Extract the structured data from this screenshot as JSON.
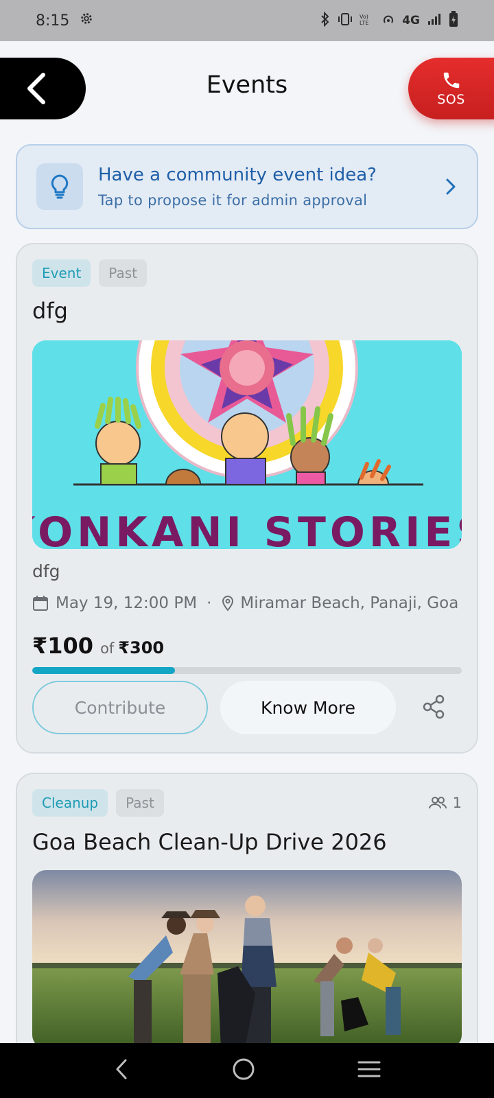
{
  "status": {
    "time": "8:15",
    "network": "4G"
  },
  "header": {
    "title": "Events",
    "sos_label": "SOS"
  },
  "idea_banner": {
    "title": "Have a community event idea?",
    "subtitle": "Tap to propose it for admin approval"
  },
  "events": [
    {
      "category": "Event",
      "status": "Past",
      "title": "dfg",
      "image_text": "KONKANI STORIES",
      "description": "dfg",
      "date": "May 19, 12:00 PM",
      "separator": "·",
      "location": "Miramar Beach, Panaji, Goa",
      "raised": "₹100",
      "of_label": "of",
      "goal": "₹300",
      "progress_fraction": 0.333,
      "contribute_label": "Contribute",
      "know_more_label": "Know More"
    },
    {
      "category": "Cleanup",
      "status": "Past",
      "participants": "1",
      "title": "Goa Beach Clean-Up Drive 2026"
    }
  ],
  "colors": {
    "accent": "#12a6c4",
    "sos": "#d72626",
    "idea_text": "#1f5fa8"
  }
}
